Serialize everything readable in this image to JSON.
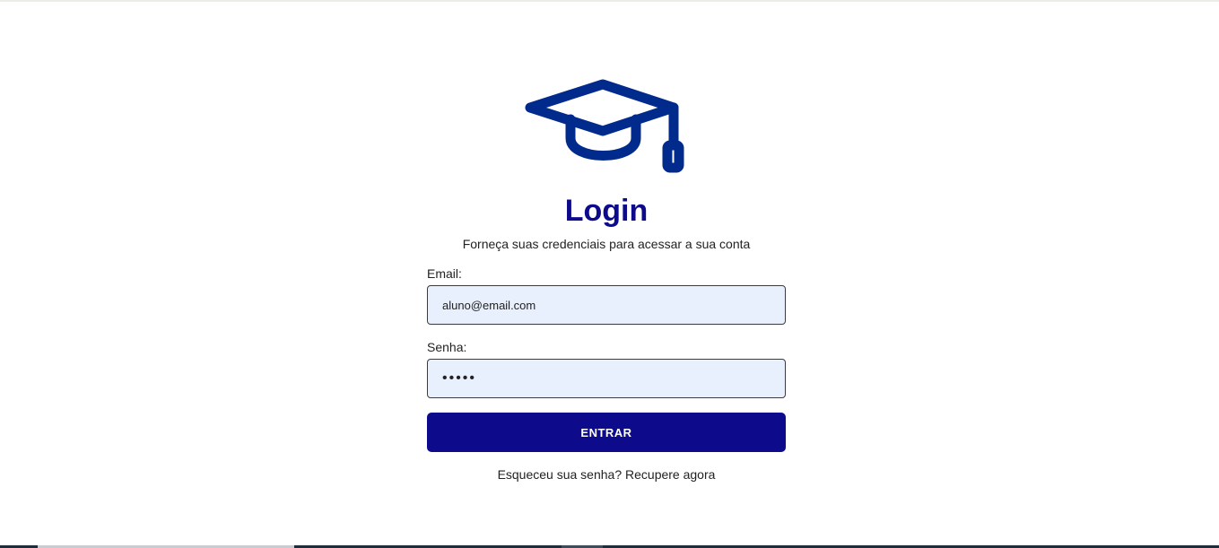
{
  "logo": {
    "icon": "graduation-cap-icon",
    "color": "#002a8c"
  },
  "login": {
    "title": "Login",
    "subtitle": "Forneça suas credenciais para acessar a sua conta",
    "email_label": "Email:",
    "email_value": "aluno@email.com",
    "password_label": "Senha:",
    "password_value": "12345",
    "submit_label": "ENTRAR",
    "forgot_text": "Esqueceu sua senha?",
    "recover_link": "Recupere agora"
  },
  "colors": {
    "primary": "#0d0a8c",
    "input_background": "#e8f0fe"
  }
}
